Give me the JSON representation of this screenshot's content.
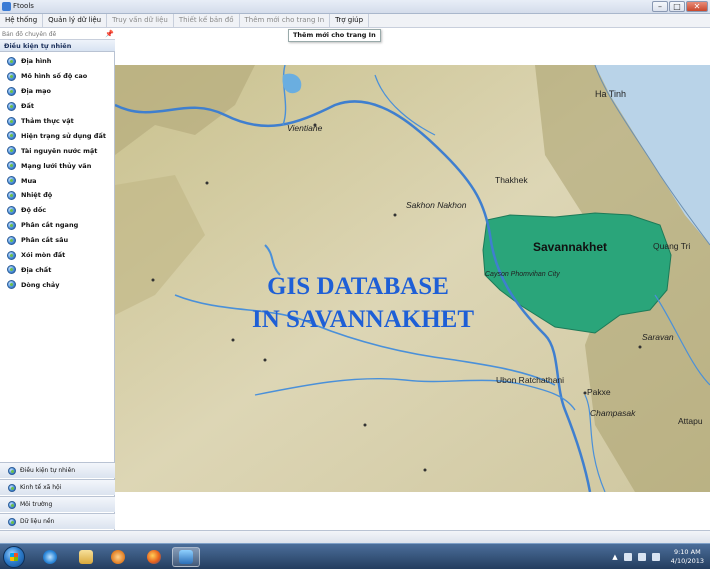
{
  "window": {
    "title": "Ftools",
    "minimize": "–",
    "maximize": "□",
    "close": "✕"
  },
  "menu": {
    "items": [
      {
        "label": "Hệ thống",
        "enabled": true
      },
      {
        "label": "Quản lý dữ liệu",
        "enabled": true
      },
      {
        "label": "Truy vấn dữ liệu",
        "enabled": false
      },
      {
        "label": "Thiết kế bản đồ",
        "enabled": false
      },
      {
        "label": "Thêm mới cho trang In",
        "enabled": false
      },
      {
        "label": "Trợ giúp",
        "enabled": true
      }
    ],
    "tooltip": "Thêm mới cho trang In"
  },
  "sidebar": {
    "search_placeholder": "Bản đồ chuyên đề",
    "pin_icon": "pin-icon",
    "section_title": "Điều kiện tự nhiên",
    "items": [
      "Địa hình",
      "Mô hình số độ cao",
      "Địa mạo",
      "Đất",
      "Thảm thực vật",
      "Hiện trạng sử dụng đất",
      "Tài nguyên nước mặt",
      "Mạng lưới thủy văn",
      "Mưa",
      "Nhiệt độ",
      "Độ dốc",
      "Phân cắt ngang",
      "Phân cắt sâu",
      "Xói mòn đất",
      "Địa chất",
      "Dòng chảy"
    ],
    "item_icon": "globe-icon",
    "nav_groups": [
      "Điều kiện tự nhiên",
      "Kinh tế xã hội",
      "Môi trường",
      "Dữ liệu nền"
    ]
  },
  "map": {
    "title_line1": "GIS DATABASE",
    "title_line2": "IN SAVANNAKHET",
    "title_color": "#1e5fd6",
    "highlight_region": "Savannakhet",
    "highlight_color": "#2aa57a",
    "water_color": "#4a90d9",
    "labels": {
      "ha_tinh": "Ha Tinh",
      "vientiane": "Vientiane",
      "thakhek": "Thakhek",
      "sakhon_nakhon": "Sakhon Nakhon",
      "savannakhet": "Savannakhet",
      "quang_tri": "Quang Tri",
      "kayson": "Cayson Phomvihan City",
      "saravan": "Saravan",
      "ubon": "Ubon Ratchathani",
      "pakxe": "Pakxe",
      "champasak": "Champasak",
      "attapu": "Attapu"
    }
  },
  "taskbar": {
    "icons": [
      "windows-start-icon",
      "internet-explorer-icon",
      "file-explorer-icon",
      "media-player-icon",
      "firefox-icon",
      "ftools-app-icon"
    ],
    "tray_arrow": "▲",
    "time": "9:10 AM",
    "date": "4/10/2013"
  }
}
